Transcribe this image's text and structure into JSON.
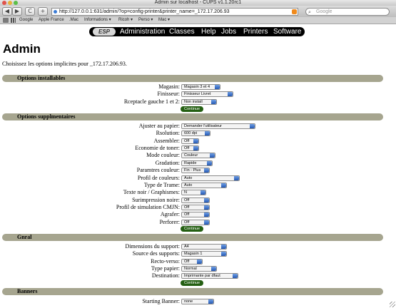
{
  "window": {
    "title": "Admin sur localhost - CUPS v1.1.20rc1"
  },
  "toolbar": {
    "url": "http://127.0.0.1:631/admin/?op=config-printer&printer_name=_172.17.206.93",
    "search_placeholder": "Google",
    "back_label": "◀",
    "forward_label": "▶",
    "reload_label": "C",
    "add_label": "+"
  },
  "bookmarks": [
    "Google",
    "Apple France",
    ".Mac",
    "Informations ▾",
    "Ricoh ▾",
    "Perso ▾",
    "Mac ▾"
  ],
  "nav": {
    "esp": "ESP",
    "items": [
      "Administration",
      "Classes",
      "Help",
      "Jobs",
      "Printers",
      "Software"
    ]
  },
  "page": {
    "title": "Admin",
    "intro": "Choisissez les options implicites pour _172.17.206.93."
  },
  "sections": [
    {
      "title": "Options installables",
      "options": [
        {
          "label": "Magasin:",
          "value": "Magasin 3 et 4"
        },
        {
          "label": "Finisseur:",
          "value": "Finisseur Livret"
        },
        {
          "label": "Rceptacle gauche 1 et 2:",
          "value": "Non install"
        }
      ],
      "button": "Continue"
    },
    {
      "title": "Options supplmentaires",
      "options": [
        {
          "label": "Ajuster au papier:",
          "value": "Demander  l'utilisateur"
        },
        {
          "label": "Rsolution:",
          "value": "600 dpi"
        },
        {
          "label": "Assembler:",
          "value": "Off"
        },
        {
          "label": "Economie de toner:",
          "value": "Off"
        },
        {
          "label": "Mode couleur:",
          "value": "Couleur"
        },
        {
          "label": "Gradation:",
          "value": "Rapide"
        },
        {
          "label": "Paramtres couleur:",
          "value": "Fin - Plus"
        },
        {
          "label": "Profil de couleurs:",
          "value": "Auto"
        },
        {
          "label": "Type de Trame:",
          "value": "Auto"
        },
        {
          "label": "Texte noir / Graphismes:",
          "value": "N"
        },
        {
          "label": "Surimpression noire:",
          "value": "Off"
        },
        {
          "label": "Profil de simulation CMJN:",
          "value": "Off"
        },
        {
          "label": "Agrafer:",
          "value": "Off"
        },
        {
          "label": "Perforer:",
          "value": "Off"
        }
      ],
      "button": "Continue"
    },
    {
      "title": "Gnral",
      "options": [
        {
          "label": "Dimensions du support:",
          "value": "A4"
        },
        {
          "label": "Source des supports:",
          "value": "Magasin 1"
        },
        {
          "label": "Recto-verso:",
          "value": "Off"
        },
        {
          "label": "Type papier:",
          "value": "Normal"
        },
        {
          "label": "Destination:",
          "value": "Imprimante par dfaut"
        }
      ],
      "button": "Continue"
    },
    {
      "title": "Banners",
      "options": [
        {
          "label": "Starting Banner:",
          "value": "none"
        }
      ]
    }
  ],
  "colors": {
    "section_bar": "#a6a58f",
    "continue_button": "#245f12",
    "nav_bar": "#000000"
  }
}
